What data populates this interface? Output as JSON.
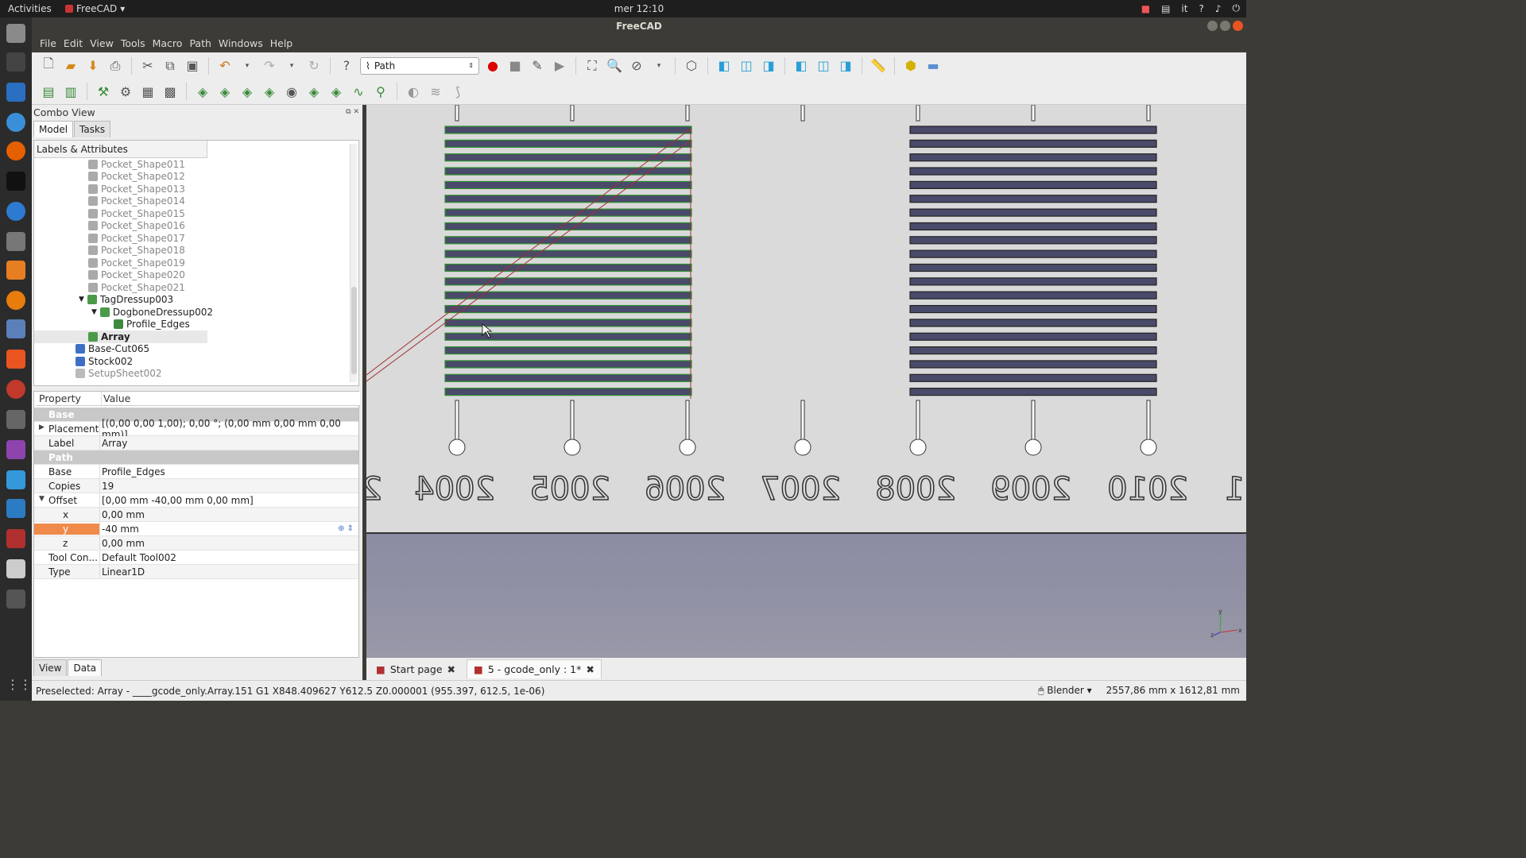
{
  "topbar": {
    "activities": "Activities",
    "app_name": "FreeCAD",
    "clock": "mer 12:10",
    "language": "it"
  },
  "window": {
    "title": "FreeCAD"
  },
  "menu": [
    "File",
    "Edit",
    "View",
    "Tools",
    "Macro",
    "Path",
    "Windows",
    "Help"
  ],
  "toolbar": {
    "workbench": "Path"
  },
  "combo_view": {
    "title": "Combo View",
    "tabs": [
      "Model",
      "Tasks"
    ],
    "tree_header": "Labels & Attributes",
    "tree_items": [
      {
        "label": "Pocket_Shape011",
        "dim": true
      },
      {
        "label": "Pocket_Shape012",
        "dim": true
      },
      {
        "label": "Pocket_Shape013",
        "dim": true
      },
      {
        "label": "Pocket_Shape014",
        "dim": true
      },
      {
        "label": "Pocket_Shape015",
        "dim": true
      },
      {
        "label": "Pocket_Shape016",
        "dim": true
      },
      {
        "label": "Pocket_Shape017",
        "dim": true
      },
      {
        "label": "Pocket_Shape018",
        "dim": true
      },
      {
        "label": "Pocket_Shape019",
        "dim": true
      },
      {
        "label": "Pocket_Shape020",
        "dim": true
      },
      {
        "label": "Pocket_Shape021",
        "dim": true
      },
      {
        "label": "TagDressup003"
      },
      {
        "label": "DogboneDressup002"
      },
      {
        "label": "Profile_Edges"
      },
      {
        "label": "Array"
      },
      {
        "label": "Base-Cut065"
      },
      {
        "label": "Stock002"
      },
      {
        "label": "SetupSheet002",
        "dim": true
      }
    ],
    "property_header": {
      "property": "Property",
      "value": "Value"
    },
    "properties": [
      {
        "group": "Base"
      },
      {
        "key": "Placement",
        "value": "[(0,00 0,00 1,00); 0,00 °; (0,00 mm  0,00 mm  0,00 mm)]",
        "expandable": true
      },
      {
        "key": "Label",
        "value": "Array"
      },
      {
        "group": "Path"
      },
      {
        "key": "Base",
        "value": "Profile_Edges"
      },
      {
        "key": "Copies",
        "value": "19"
      },
      {
        "key": "Offset",
        "value": "[0,00 mm  -40,00 mm  0,00 mm]",
        "expanded": true
      },
      {
        "key": "x",
        "value": "0,00 mm",
        "child": true
      },
      {
        "key": "y",
        "value": "-40 mm",
        "child": true,
        "selected": true
      },
      {
        "key": "z",
        "value": "0,00 mm",
        "child": true
      },
      {
        "key": "Tool Con...",
        "value": "Default Tool002"
      },
      {
        "key": "Type",
        "value": "Linear1D"
      }
    ],
    "bottom_tabs": [
      "View",
      "Data"
    ]
  },
  "viewport": {
    "year_labels": [
      "2004",
      "2005",
      "2006",
      "2007",
      "2008",
      "2009",
      "2010"
    ],
    "partial_labels": [
      "2",
      "1"
    ],
    "bar_count": 20,
    "axis_labels": {
      "x": "x",
      "y": "y",
      "z": "z"
    }
  },
  "doc_tabs": [
    "Start page",
    "5 - gcode_only : 1*"
  ],
  "status": {
    "message": "Preselected: Array - ____gcode_only.Array.151 G1 X848.409627 Y612.5 Z0.000001 (955.397, 612.5, 1e-06)",
    "nav_style": "Blender",
    "dimensions": "2557,86 mm x 1612,81 mm"
  }
}
